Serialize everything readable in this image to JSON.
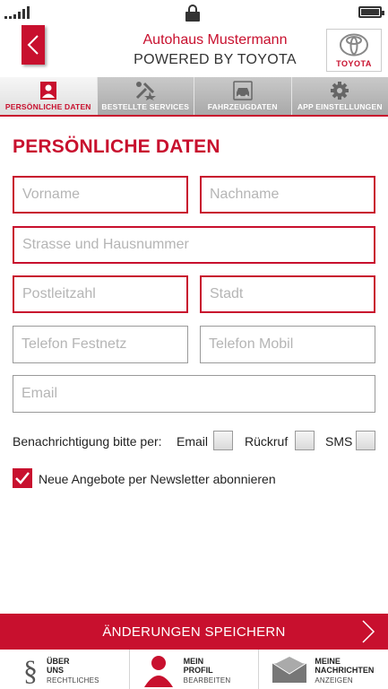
{
  "header": {
    "title": "Autohaus Mustermann",
    "subtitle": "POWERED BY TOYOTA",
    "logo_text": "TOYOTA"
  },
  "tabs": [
    {
      "label": "PERSÖNLICHE DATEN",
      "icon": "person-icon",
      "active": true
    },
    {
      "label": "BESTELLTE SERVICES",
      "icon": "tools-icon",
      "active": false
    },
    {
      "label": "FAHRZEUGDATEN",
      "icon": "car-icon",
      "active": false
    },
    {
      "label": "APP EINSTELLUNGEN",
      "icon": "gear-icon",
      "active": false
    }
  ],
  "form": {
    "title": "PERSÖNLICHE DATEN",
    "first_name": {
      "placeholder": "Vorname",
      "value": ""
    },
    "last_name": {
      "placeholder": "Nachname",
      "value": ""
    },
    "street": {
      "placeholder": "Strasse und Hausnummer",
      "value": ""
    },
    "zip": {
      "placeholder": "Postleitzahl",
      "value": ""
    },
    "city": {
      "placeholder": "Stadt",
      "value": ""
    },
    "phone_landline": {
      "placeholder": "Telefon Festnetz",
      "value": ""
    },
    "phone_mobile": {
      "placeholder": "Telefon Mobil",
      "value": ""
    },
    "email": {
      "placeholder": "Email",
      "value": ""
    }
  },
  "notification": {
    "label": "Benachrichtigung bitte per:",
    "options": [
      {
        "label": "Email",
        "checked": false
      },
      {
        "label": "Rückruf",
        "checked": false
      },
      {
        "label": "SMS",
        "checked": false
      }
    ]
  },
  "newsletter": {
    "label": "Neue Angebote per Newsletter abonnieren",
    "checked": true
  },
  "save_button": {
    "label": "ÄNDERUNGEN SPEICHERN"
  },
  "bottom_nav": [
    {
      "title_line1": "ÜBER",
      "title_line2": "UNS",
      "sub": "RECHTLICHES",
      "icon": "paragraph-icon"
    },
    {
      "title_line1": "MEIN",
      "title_line2": "PROFIL",
      "sub": "BEARBEITEN",
      "icon": "profile-icon"
    },
    {
      "title_line1": "MEINE",
      "title_line2": "NACHRICHTEN",
      "sub": "ANZEIGEN",
      "icon": "envelope-icon"
    }
  ],
  "colors": {
    "accent": "#c8102e",
    "tab_bg": "#b3b3b3",
    "border_gray": "#9a9a9a"
  }
}
